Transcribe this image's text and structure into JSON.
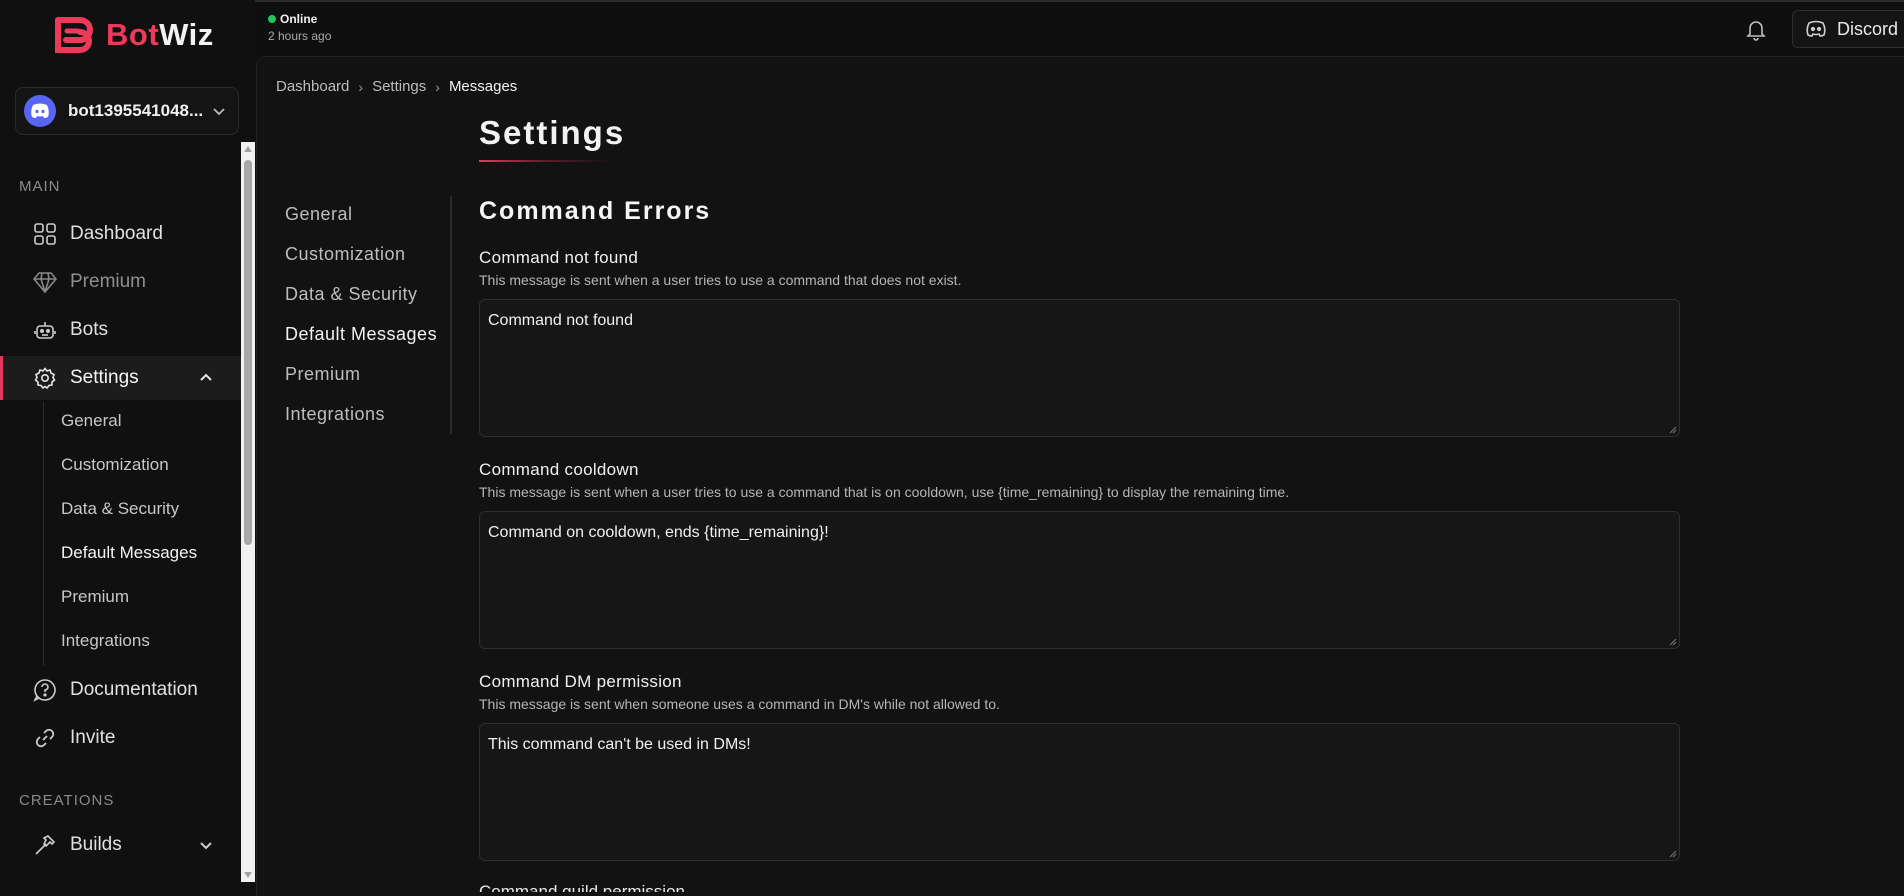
{
  "brand": {
    "part1": "Bot",
    "part2": "Wiz"
  },
  "bot_selector": {
    "name": "bot1395541048..."
  },
  "sidebar": {
    "main_label": "MAIN",
    "items": [
      {
        "label": "Dashboard"
      },
      {
        "label": "Premium"
      },
      {
        "label": "Bots"
      },
      {
        "label": "Settings"
      },
      {
        "label": "Documentation"
      },
      {
        "label": "Invite"
      }
    ],
    "settings_sub": [
      {
        "label": "General"
      },
      {
        "label": "Customization"
      },
      {
        "label": "Data & Security"
      },
      {
        "label": "Default Messages"
      },
      {
        "label": "Premium"
      },
      {
        "label": "Integrations"
      }
    ],
    "creations_label": "CREATIONS",
    "builds_label": "Builds"
  },
  "header": {
    "status": "Online",
    "last_seen": "2 hours ago",
    "discord_label": "Discord"
  },
  "breadcrumb": [
    "Dashboard",
    "Settings",
    "Messages"
  ],
  "page": {
    "title": "Settings"
  },
  "subnav": [
    {
      "label": "General"
    },
    {
      "label": "Customization"
    },
    {
      "label": "Data & Security"
    },
    {
      "label": "Default Messages"
    },
    {
      "label": "Premium"
    },
    {
      "label": "Integrations"
    }
  ],
  "section": {
    "title": "Command Errors",
    "fields": [
      {
        "label": "Command not found",
        "description": "This message is sent when a user tries to use a command that does not exist.",
        "value": "Command not found"
      },
      {
        "label": "Command cooldown",
        "description": "This message is sent when a user tries to use a command that is on cooldown, use {time_remaining} to display the remaining time.",
        "value": "Command on cooldown, ends {time_remaining}!"
      },
      {
        "label": "Command DM permission",
        "description": "This message is sent when someone uses a command in DM's while not allowed to.",
        "value": "This command can't be used in DMs!"
      }
    ],
    "next_label": "Command guild permission"
  },
  "colors": {
    "accent": "#e5375a",
    "online": "#22c55e",
    "discord": "#5865f2"
  }
}
